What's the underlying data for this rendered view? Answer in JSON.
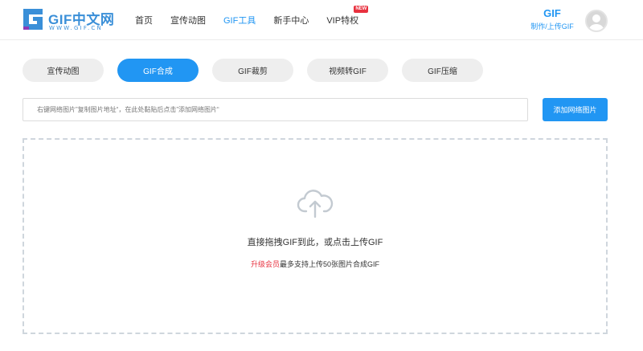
{
  "header": {
    "logo": {
      "name": "GIF中文网",
      "sub": "WWW.GIF.CN"
    },
    "nav": [
      {
        "label": "首页"
      },
      {
        "label": "宣传动图"
      },
      {
        "label": "GIF工具"
      },
      {
        "label": "新手中心"
      },
      {
        "label": "VIP特权",
        "badge": "NEW"
      }
    ],
    "active_nav": "GIF工具",
    "gif_link": {
      "title": "GIF",
      "subtitle": "制作/上传GIF"
    }
  },
  "tabs": [
    {
      "label": "宣传动图"
    },
    {
      "label": "GIF合成"
    },
    {
      "label": "GIF裁剪"
    },
    {
      "label": "视频转GIF"
    },
    {
      "label": "GIF压缩"
    }
  ],
  "active_tab": "GIF合成",
  "url_bar": {
    "placeholder": "右键网络图片”复制图片地址“，在此处黏贴后点击”添加网络图片“",
    "button_label": "添加网络图片"
  },
  "dropzone": {
    "title": "直接拖拽GIF到此，或点击上传GIF",
    "vip_link": "升级会员",
    "hint": "最多支持上传50张图片合成GIF"
  },
  "colors": {
    "accent": "#2196f3",
    "danger": "#e8313f",
    "tab_bg": "#eeeeee",
    "dashed_border": "#cfd6dd"
  },
  "icons": [
    "logo-g-icon",
    "avatar-user-icon",
    "cloud-upload-icon"
  ]
}
